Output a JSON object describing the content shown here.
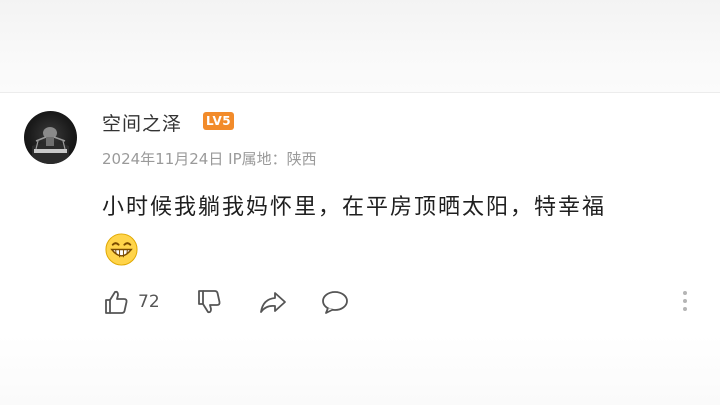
{
  "comment": {
    "username": "空间之泽",
    "level_badge": "LV5",
    "date": "2024年11月24日",
    "ip_location": "IP属地：陕西",
    "text": "小时候我躺我妈怀里，在平房顶晒太阳，特幸福",
    "emoji": "grinning-face-emoji",
    "like_count": "72"
  },
  "colors": {
    "badge": "#f28b2a",
    "meta_text": "#9a9a9a",
    "icon": "#555555"
  },
  "icons": [
    "thumbs-up-icon",
    "thumbs-down-icon",
    "share-icon",
    "reply-icon",
    "more-icon"
  ]
}
